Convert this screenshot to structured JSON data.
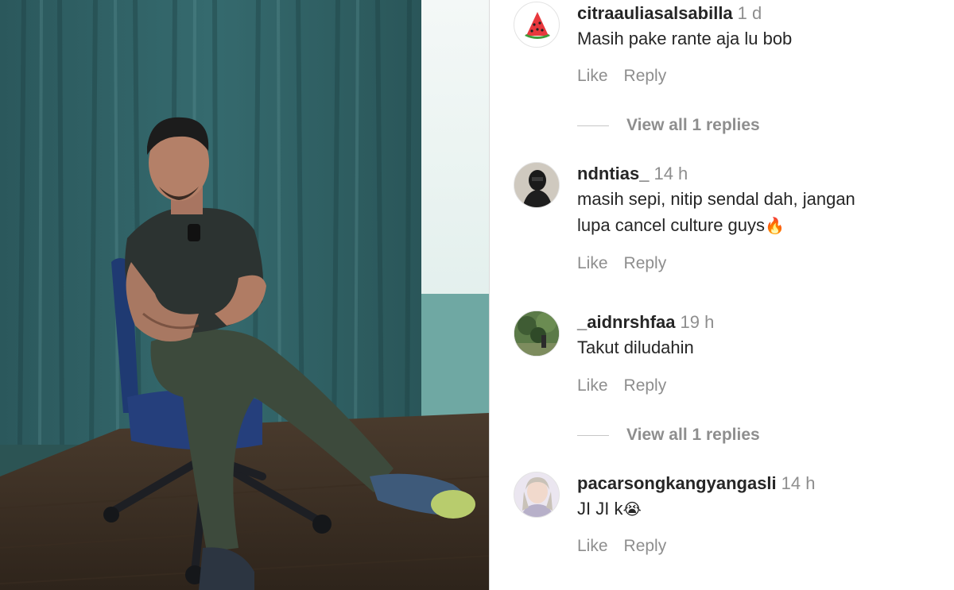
{
  "comments": [
    {
      "username": "citraauliasalsabilla",
      "time": "1 d",
      "text_lines": [
        "Masih pake rante aja lu bob"
      ],
      "like_label": "Like",
      "reply_label": "Reply",
      "view_replies": "View all 1 replies",
      "avatar_icon": "watermelon-icon"
    },
    {
      "username": "ndntias_",
      "time": "14 h",
      "text_lines": [
        "masih sepi, nitip sendal dah, jangan",
        "lupa cancel culture guys"
      ],
      "emoji": "🔥",
      "like_label": "Like",
      "reply_label": "Reply"
    },
    {
      "username": "_aidnrshfaa",
      "time": "19 h",
      "text_lines": [
        "Takut diludahin"
      ],
      "like_label": "Like",
      "reply_label": "Reply",
      "view_replies": "View all 1 replies"
    },
    {
      "username": "pacarsongkangyangasli",
      "time": "14 h",
      "text_lines": [
        "JI JI k"
      ],
      "emoji": "😭",
      "like_label": "Like",
      "reply_label": "Reply"
    }
  ],
  "colors": {
    "username": "#262626",
    "meta": "#8e8e8e",
    "curtain": "#2f5f63"
  }
}
